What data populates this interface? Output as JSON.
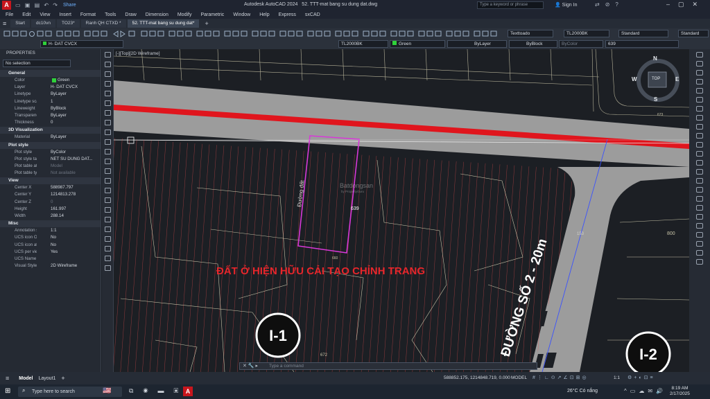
{
  "titlebar": {
    "logo": "A",
    "share": "Share",
    "app_title": "Autodesk AutoCAD 2024",
    "file_title": "52. TTT-mat bang su dung dat.dwg",
    "search_placeholder": "Type a keyword or phrase",
    "sign_in": "Sign In"
  },
  "menu": [
    "File",
    "Edit",
    "View",
    "Insert",
    "Format",
    "Tools",
    "Draw",
    "Dimension",
    "Modify",
    "Parametric",
    "Window",
    "Help",
    "Express",
    "sxCAD"
  ],
  "tabs": [
    {
      "label": "Start"
    },
    {
      "label": "dc10vn"
    },
    {
      "label": "TO23*"
    },
    {
      "label": "Ranh QH CTXD *"
    },
    {
      "label": "52. TTT-mat bang su dung dat*"
    }
  ],
  "ribbon": {
    "text_style": "Texttoado",
    "dim_style": "TL2000BK",
    "table_style": "Standard",
    "mleader_style": "Standard",
    "layer": "H- DAT CVCX",
    "layer_combo2": "TL2000BK",
    "color": "Green",
    "linetype": "ByLayer",
    "lineweight": "ByBlock",
    "plotstyle": "ByColor",
    "search_value": "639"
  },
  "properties": {
    "header": "PROPERTIES",
    "selection": "No selection",
    "sections": [
      {
        "title": "General",
        "rows": [
          {
            "k": "Color",
            "v": "Green"
          },
          {
            "k": "Layer",
            "v": "H- DAT CVCX"
          },
          {
            "k": "Linetype",
            "v": "ByLayer"
          },
          {
            "k": "Linetype scale",
            "v": "1"
          },
          {
            "k": "Lineweight",
            "v": "ByBlock"
          },
          {
            "k": "Transparency",
            "v": "ByLayer"
          },
          {
            "k": "Thickness",
            "v": "0"
          }
        ]
      },
      {
        "title": "3D Visualization",
        "rows": [
          {
            "k": "Material",
            "v": "ByLayer"
          }
        ]
      },
      {
        "title": "Plot style",
        "rows": [
          {
            "k": "Plot style",
            "v": "ByColor"
          },
          {
            "k": "Plot style table",
            "v": "NET SU DUNG DAT..."
          },
          {
            "k": "Plot table attac...",
            "v": "Model"
          },
          {
            "k": "Plot table type",
            "v": "Not available"
          }
        ]
      },
      {
        "title": "View",
        "rows": [
          {
            "k": "Center X",
            "v": "588987.797"
          },
          {
            "k": "Center Y",
            "v": "1214813.278"
          },
          {
            "k": "Center Z",
            "v": "0"
          },
          {
            "k": "Height",
            "v": "161.997"
          },
          {
            "k": "Width",
            "v": "288.14"
          }
        ]
      },
      {
        "title": "Misc",
        "rows": [
          {
            "k": "Annotation scale",
            "v": "1:1"
          },
          {
            "k": "UCS icon On",
            "v": "No"
          },
          {
            "k": "UCS icon at ori...",
            "v": "No"
          },
          {
            "k": "UCS per viewp...",
            "v": "Yes"
          },
          {
            "k": "UCS Name",
            "v": ""
          },
          {
            "k": "Visual Style",
            "v": "2D Wireframe"
          }
        ]
      }
    ]
  },
  "viewport": {
    "label": "[-][Top][2D Wireframe]",
    "compass": {
      "n": "N",
      "s": "S",
      "e": "E",
      "w": "W",
      "top": "TOP"
    },
    "lot_number": "639",
    "lot_small": "660",
    "lot_num2": "153",
    "lot_num3": "672",
    "lot_num4": "800",
    "lot_num5": "673",
    "watermark": "Batdongsan",
    "watermark_sub": "by PropertyGuru",
    "vertical_text": "Đường đất",
    "land_label": "ĐẤT Ở HIỆN HỮU CẢI TẠO CHỈNH TRANG",
    "road_label": "ĐƯỜNG SỐ 2 - 20m",
    "zone1": "I-1",
    "zone2": "I-2"
  },
  "command_placeholder": "Type a command",
  "status": {
    "model_tab": "Model",
    "layout_tab": "Layout1",
    "coords": "588852.175, 1214848.719, 0.000",
    "model": "MODEL",
    "scale": "1:1"
  },
  "taskbar": {
    "search": "Type here to search",
    "weather": "26°C Có nắng",
    "time": "8:19 AM",
    "date": "2/17/2025"
  },
  "colors": {
    "accent_red": "#e0151d",
    "lot_magenta": "#d838d8",
    "road_gray": "#9c9c9c",
    "label_red": "#e8262b"
  }
}
